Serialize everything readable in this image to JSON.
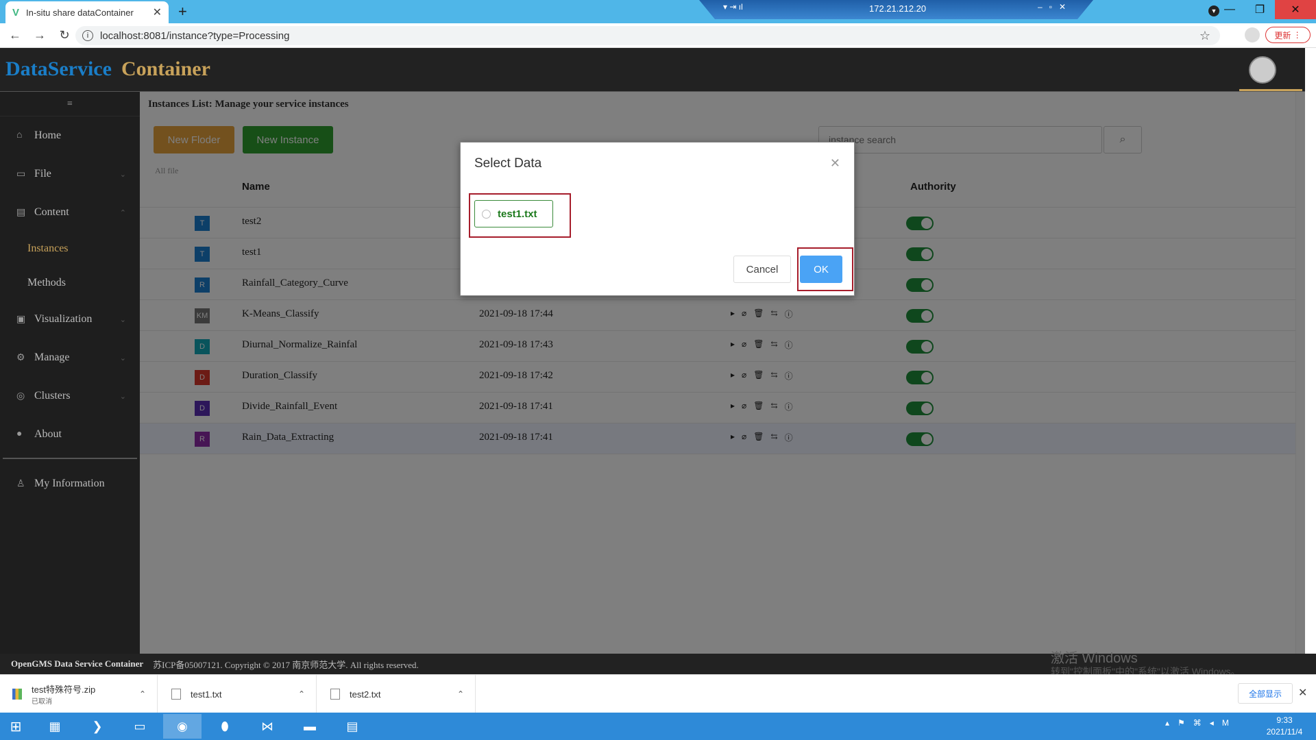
{
  "browser": {
    "tab_title": "In-situ share dataContainer",
    "url": "localhost:8081/instance?type=Processing",
    "update_label": "更新",
    "remote_ip": "172.21.212.20"
  },
  "app": {
    "logo_part1": "DataService",
    "logo_part2": "Container"
  },
  "sidebar": {
    "items": [
      {
        "label": "Home",
        "icon": "home-icon"
      },
      {
        "label": "File",
        "icon": "folder-icon"
      },
      {
        "label": "Content",
        "icon": "content-icon"
      },
      {
        "label": "Instances",
        "icon": ""
      },
      {
        "label": "Methods",
        "icon": ""
      },
      {
        "label": "Visualization",
        "icon": "image-icon"
      },
      {
        "label": "Manage",
        "icon": "gear-icon"
      },
      {
        "label": "Clusters",
        "icon": "cluster-icon"
      },
      {
        "label": "About",
        "icon": "info-icon"
      },
      {
        "label": "My Information",
        "icon": "user-icon"
      }
    ]
  },
  "main": {
    "title": "Instances List: Manage your service instances",
    "new_folder_label": "New Floder",
    "new_instance_label": "New Instance",
    "search_placeholder": "instance search",
    "breadcrumb": "All file",
    "columns": {
      "name": "Name",
      "authority": "Authority"
    },
    "rows": [
      {
        "badge": "T",
        "badge_color": "#1b7fd1",
        "name": "test2",
        "date": ""
      },
      {
        "badge": "T",
        "badge_color": "#1b7fd1",
        "name": "test1",
        "date": ""
      },
      {
        "badge": "R",
        "badge_color": "#1b7fd1",
        "name": "Rainfall_Category_Curve",
        "date": ""
      },
      {
        "badge": "KM",
        "badge_color": "#777777",
        "name": "K-Means_Classify",
        "date": "2021-09-18 17:44"
      },
      {
        "badge": "D",
        "badge_color": "#12a8b8",
        "name": "Diurnal_Normalize_Rainfal",
        "date": "2021-09-18 17:43"
      },
      {
        "badge": "D",
        "badge_color": "#d9362b",
        "name": "Duration_Classify",
        "date": "2021-09-18 17:42"
      },
      {
        "badge": "D",
        "badge_color": "#5a2fb5",
        "name": "Divide_Rainfall_Event",
        "date": "2021-09-18 17:41"
      },
      {
        "badge": "R",
        "badge_color": "#8e2aa8",
        "name": "Rain_Data_Extracting",
        "date": "2021-09-18 17:41"
      }
    ]
  },
  "modal": {
    "title": "Select Data",
    "option_label": "test1.txt",
    "cancel_label": "Cancel",
    "ok_label": "OK"
  },
  "footer": {
    "brand": "OpenGMS Data Service Container",
    "copyright": "苏ICP备05007121. Copyright © 2017 南京师范大学. All rights reserved.",
    "watermark_title": "激活 Windows",
    "watermark_sub": "转到\"控制面板\"中的\"系统\"以激活 Windows。"
  },
  "downloads": {
    "items": [
      {
        "name": "test特殊符号.zip",
        "status": "已取消"
      },
      {
        "name": "test1.txt",
        "status": ""
      },
      {
        "name": "test2.txt",
        "status": ""
      }
    ],
    "show_all_label": "全部显示"
  },
  "taskbar": {
    "time": "9:33",
    "date": "2021/11/4"
  }
}
